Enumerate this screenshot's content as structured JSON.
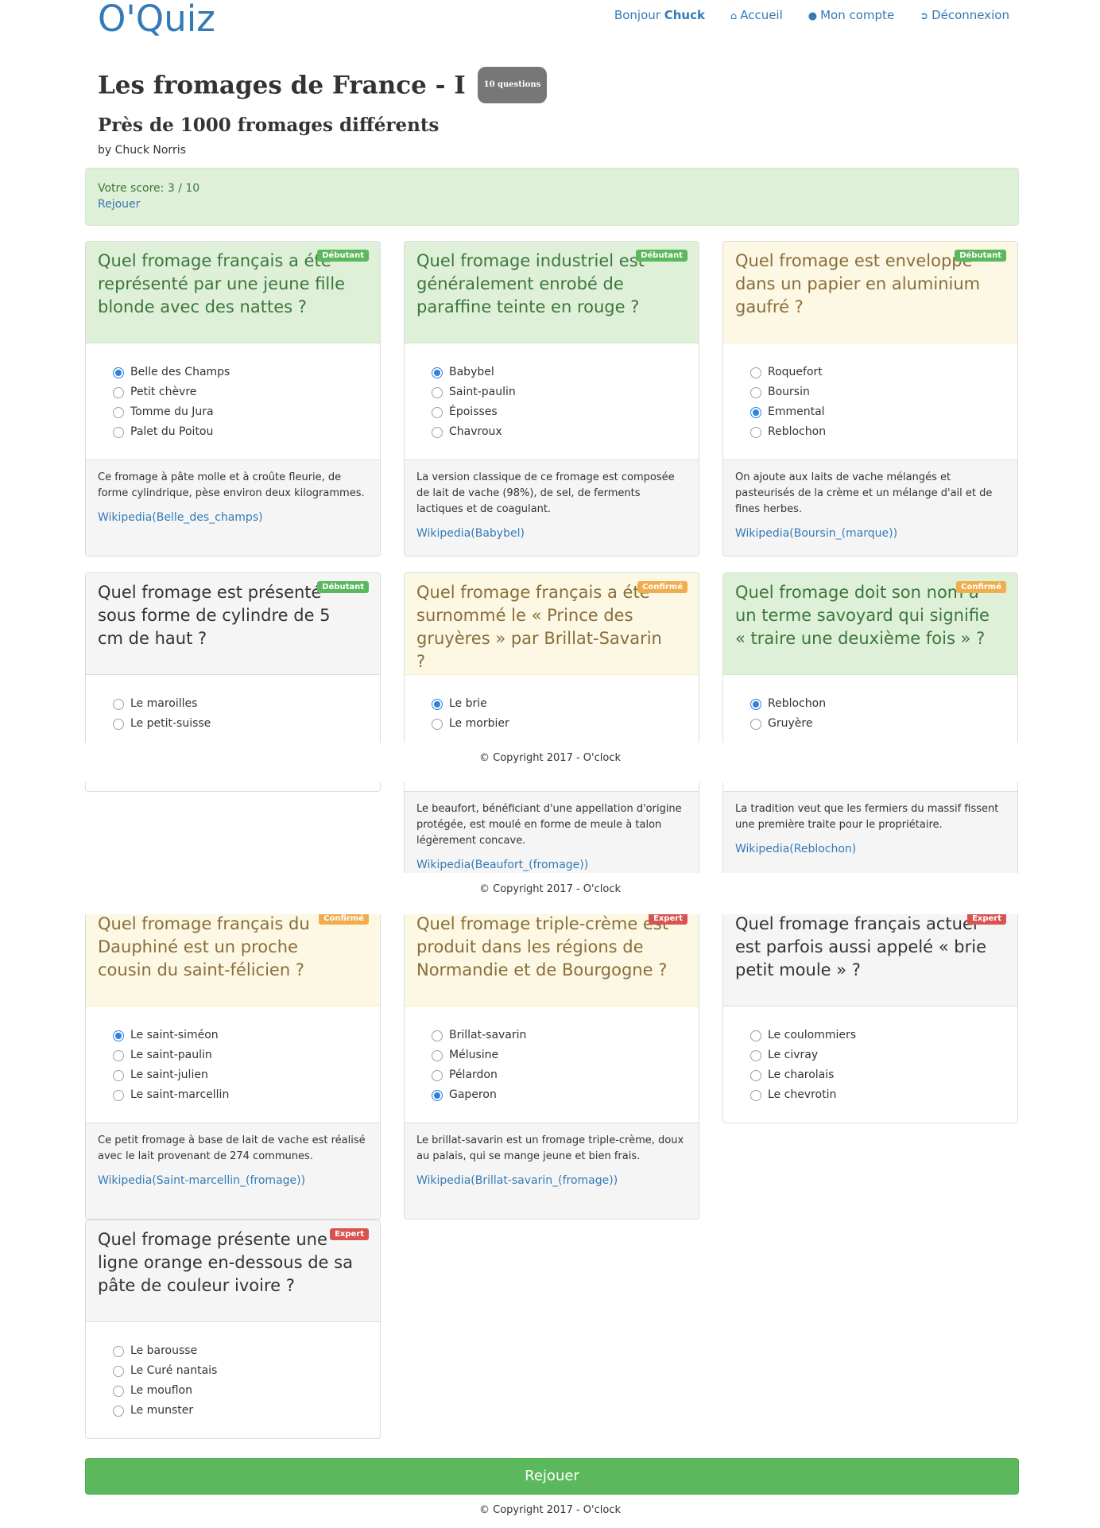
{
  "brand": "O'Quiz",
  "nav": {
    "greeting": "Bonjour",
    "username": "Chuck",
    "home": "Accueil",
    "account": "Mon compte",
    "logout": "Déconnexion"
  },
  "quiz": {
    "title": "Les fromages de France - I",
    "count_badge": "10 questions",
    "subtitle": "Près de 1000 fromages différents",
    "author": "by Chuck Norris"
  },
  "score": {
    "text": "Votre score: 3 / 10",
    "replay_link": "Rejouer"
  },
  "questions": [
    {
      "question": "Quel fromage français a été représenté par une jeune fille blonde avec des nattes ?",
      "level": "Débutant",
      "level_class": "debutant",
      "status": "success",
      "options": [
        "Belle des Champs",
        "Petit chèvre",
        "Tomme du Jura",
        "Palet du Poitou"
      ],
      "selected": 0,
      "explanation": "Ce fromage à pâte molle et à croûte fleurie, de forme cylindrique, pèse environ deux kilogrammes.",
      "wiki": "Wikipedia(Belle_des_champs)"
    },
    {
      "question": "Quel fromage industriel est généralement enrobé de paraffine teinte en rouge ?",
      "level": "Débutant",
      "level_class": "debutant",
      "status": "success",
      "options": [
        "Babybel",
        "Saint-paulin",
        "Époisses",
        "Chavroux"
      ],
      "selected": 0,
      "explanation": "La version classique de ce fromage est composée de lait de vache (98%), de sel, de ferments lactiques et de coagulant.",
      "wiki": "Wikipedia(Babybel)"
    },
    {
      "question": "Quel fromage est enveloppé dans un papier en aluminium gaufré ?",
      "level": "Débutant",
      "level_class": "debutant",
      "status": "warning",
      "options": [
        "Roquefort",
        "Boursin",
        "Emmental",
        "Reblochon"
      ],
      "selected": 2,
      "explanation": "On ajoute aux laits de vache mélangés et pasteurisés de la crème et un mélange d'ail et de fines herbes.",
      "wiki": "Wikipedia(Boursin_(marque))"
    },
    {
      "question": "Quel fromage est présenté sous forme de cylindre de 5 cm de haut ?",
      "level": "Débutant",
      "level_class": "debutant",
      "status": "default",
      "options": [
        "Le maroilles",
        "Le petit-suisse"
      ],
      "selected": -1,
      "explanation": "",
      "wiki": ""
    },
    {
      "question": "Quel fromage français a été surnommé le « Prince des gruyères » par Brillat-Savarin ?",
      "level": "Confirmé",
      "level_class": "confirme",
      "status": "warning",
      "options": [
        "Le brie",
        "Le morbier"
      ],
      "selected": 0,
      "explanation": "Le beaufort, bénéficiant d'une appellation d'origine protégée, est moulé en forme de meule à talon légèrement concave.",
      "wiki": "Wikipedia(Beaufort_(fromage))"
    },
    {
      "question": "Quel fromage doit son nom à un terme savoyard qui signifie « traire une deuxième fois » ?",
      "level": "Confirmé",
      "level_class": "confirme",
      "status": "success",
      "options": [
        "Reblochon",
        "Gruyère"
      ],
      "selected": 0,
      "explanation": "La tradition veut que les fermiers du massif fissent une première traite pour le propriétaire.",
      "wiki": "Wikipedia(Reblochon)"
    },
    {
      "question": "Quel fromage français du Dauphiné est un proche cousin du saint-félicien ?",
      "level": "Confirmé",
      "level_class": "confirme",
      "status": "warning",
      "options": [
        "Le saint-siméon",
        "Le saint-paulin",
        "Le saint-julien",
        "Le saint-marcellin"
      ],
      "selected": 0,
      "explanation": "Ce petit fromage à base de lait de vache est réalisé avec le lait provenant de 274 communes.",
      "wiki": "Wikipedia(Saint-marcellin_(fromage))"
    },
    {
      "question": "Quel fromage triple-crème est produit dans les régions de Normandie et de Bourgogne ?",
      "level": "Expert",
      "level_class": "expert",
      "status": "warning",
      "options": [
        "Brillat-savarin",
        "Mélusine",
        "Pélardon",
        "Gaperon"
      ],
      "selected": 3,
      "explanation": "Le brillat-savarin est un fromage triple-crème, doux au palais, qui se mange jeune et bien frais.",
      "wiki": "Wikipedia(Brillat-savarin_(fromage))"
    },
    {
      "question": "Quel fromage français actuel est parfois aussi appelé « brie petit moule » ?",
      "level": "Expert",
      "level_class": "expert",
      "status": "default",
      "options": [
        "Le coulommiers",
        "Le civray",
        "Le charolais",
        "Le chevrotin"
      ],
      "selected": -1,
      "explanation": "",
      "wiki": ""
    },
    {
      "question": "Quel fromage présente une ligne orange en-dessous de sa pâte de couleur ivoire ?",
      "level": "Expert",
      "level_class": "expert",
      "status": "default",
      "options": [
        "Le barousse",
        "Le Curé nantais",
        "Le mouflon",
        "Le munster"
      ],
      "selected": -1,
      "explanation": "",
      "wiki": ""
    }
  ],
  "footer": {
    "replay_button": "Rejouer",
    "copyright": "© Copyright 2017 - O'clock"
  }
}
